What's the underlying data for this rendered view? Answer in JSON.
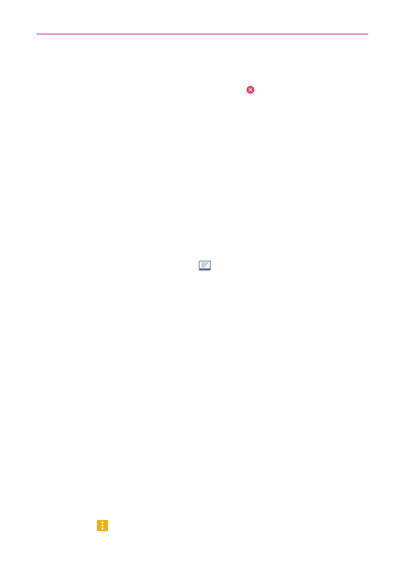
{
  "page": {
    "header_rule_color": "#c0186a"
  },
  "icons": {
    "remove": {
      "name": "remove-icon",
      "color": "#e53a5c"
    },
    "message": {
      "name": "message-icon",
      "color": "#5a6f86"
    },
    "menu": {
      "name": "more-options-icon",
      "color": "#f0b10b"
    }
  }
}
